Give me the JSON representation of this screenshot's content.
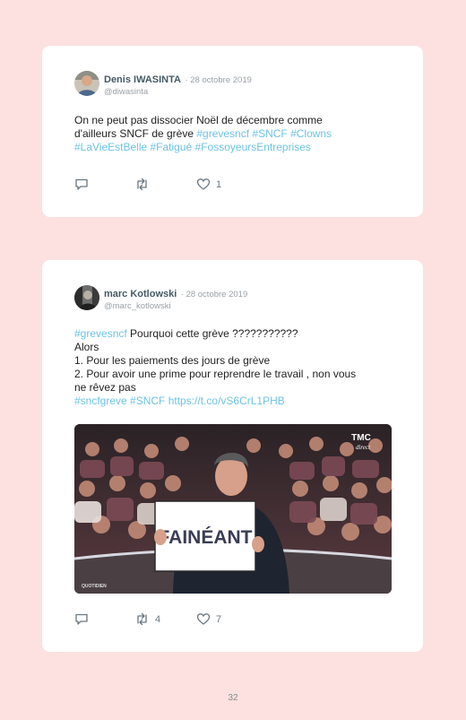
{
  "tweets": [
    {
      "name": "Denis IWASINTA",
      "date": "· 28 octobre 2019",
      "handle": "@diwasinta",
      "lines": [
        {
          "plain": "On ne peut pas dissocier Noël de décembre comme"
        },
        {
          "plain": "d'ailleurs SNCF de grève ",
          "tag": "#grevesncf #SNCF #Clowns"
        },
        {
          "tag": "#LaVieEstBelle #Fatigué #FossoyeursEntreprises"
        }
      ],
      "actions": {
        "reply_count": "",
        "retweet_count": "",
        "like_count": "1"
      },
      "icons": [
        "reply-icon",
        "retweet-icon",
        "heart-icon"
      ]
    },
    {
      "name": "marc Kotlowski",
      "date": "· 28 octobre 2019",
      "handle": "@marc_kotlowski",
      "lines": [
        {
          "tag": "#grevesncf",
          "plain": " Pourquoi cette grève ???????????"
        },
        {
          "plain": "Alors"
        },
        {
          "plain": "1. Pour les paiements des jours de grève"
        },
        {
          "plain": "2. Pour avoir une prime pour reprendre le travail , non vous"
        },
        {
          "plain": "ne rêvez pas"
        },
        {
          "tag": "#sncfgreve #SNCF https://t.co/vS6CrL1PHB"
        }
      ],
      "media": {
        "sign_text": "FAINÉANT",
        "channel_logo_top": "TMC",
        "channel_logo_bottom": "direct",
        "show_logo": "QUOTIDIEN"
      },
      "actions": {
        "reply_count": "",
        "retweet_count": "4",
        "like_count": "7"
      },
      "icons": [
        "reply-icon",
        "retweet-icon",
        "heart-icon"
      ]
    }
  ],
  "page_number": "32",
  "colors": {
    "background": "#fde0e0",
    "card": "#ffffff",
    "hashtag": "#6cc3e8",
    "name": "#455a64",
    "muted": "#9aa0a6"
  }
}
